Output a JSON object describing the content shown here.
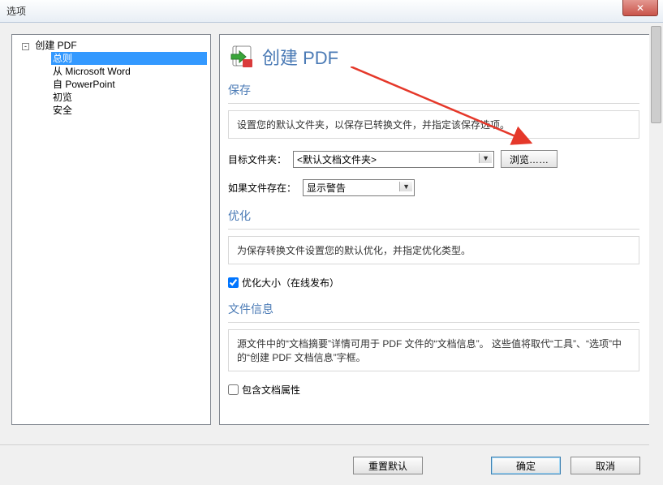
{
  "window": {
    "title": "选项",
    "close": "✕"
  },
  "tree": {
    "root": "创建 PDF",
    "items": [
      {
        "label": "总则",
        "selected": true
      },
      {
        "label": "从 Microsoft Word",
        "selected": false
      },
      {
        "label": "自 PowerPoint",
        "selected": false
      },
      {
        "label": "初览",
        "selected": false
      },
      {
        "label": "安全",
        "selected": false
      }
    ]
  },
  "header": {
    "title": "创建 PDF"
  },
  "save": {
    "section_title": "保存",
    "desc": "设置您的默认文件夹，以保存已转换文件，并指定该保存选项。",
    "target_label": "目标文件夹：",
    "target_value": "<默认文档文件夹>",
    "browse_label": "浏览……",
    "exists_label": "如果文件存在：",
    "exists_value": "显示警告"
  },
  "optimize": {
    "section_title": "优化",
    "desc": "为保存转换文件设置您的默认优化，并指定优化类型。",
    "checkbox_label": "优化大小（在线发布）",
    "checkbox_checked": true
  },
  "fileinfo": {
    "section_title": "文件信息",
    "desc": "源文件中的“文档摘要”详情可用于 PDF 文件的“文档信息”。 这些值将取代“工具”、“选项”中的“创建 PDF 文档信息”字框。",
    "checkbox_label": "包含文档属性",
    "checkbox_checked": false
  },
  "buttons": {
    "reset": "重置默认",
    "ok": "确定",
    "cancel": "取消"
  }
}
